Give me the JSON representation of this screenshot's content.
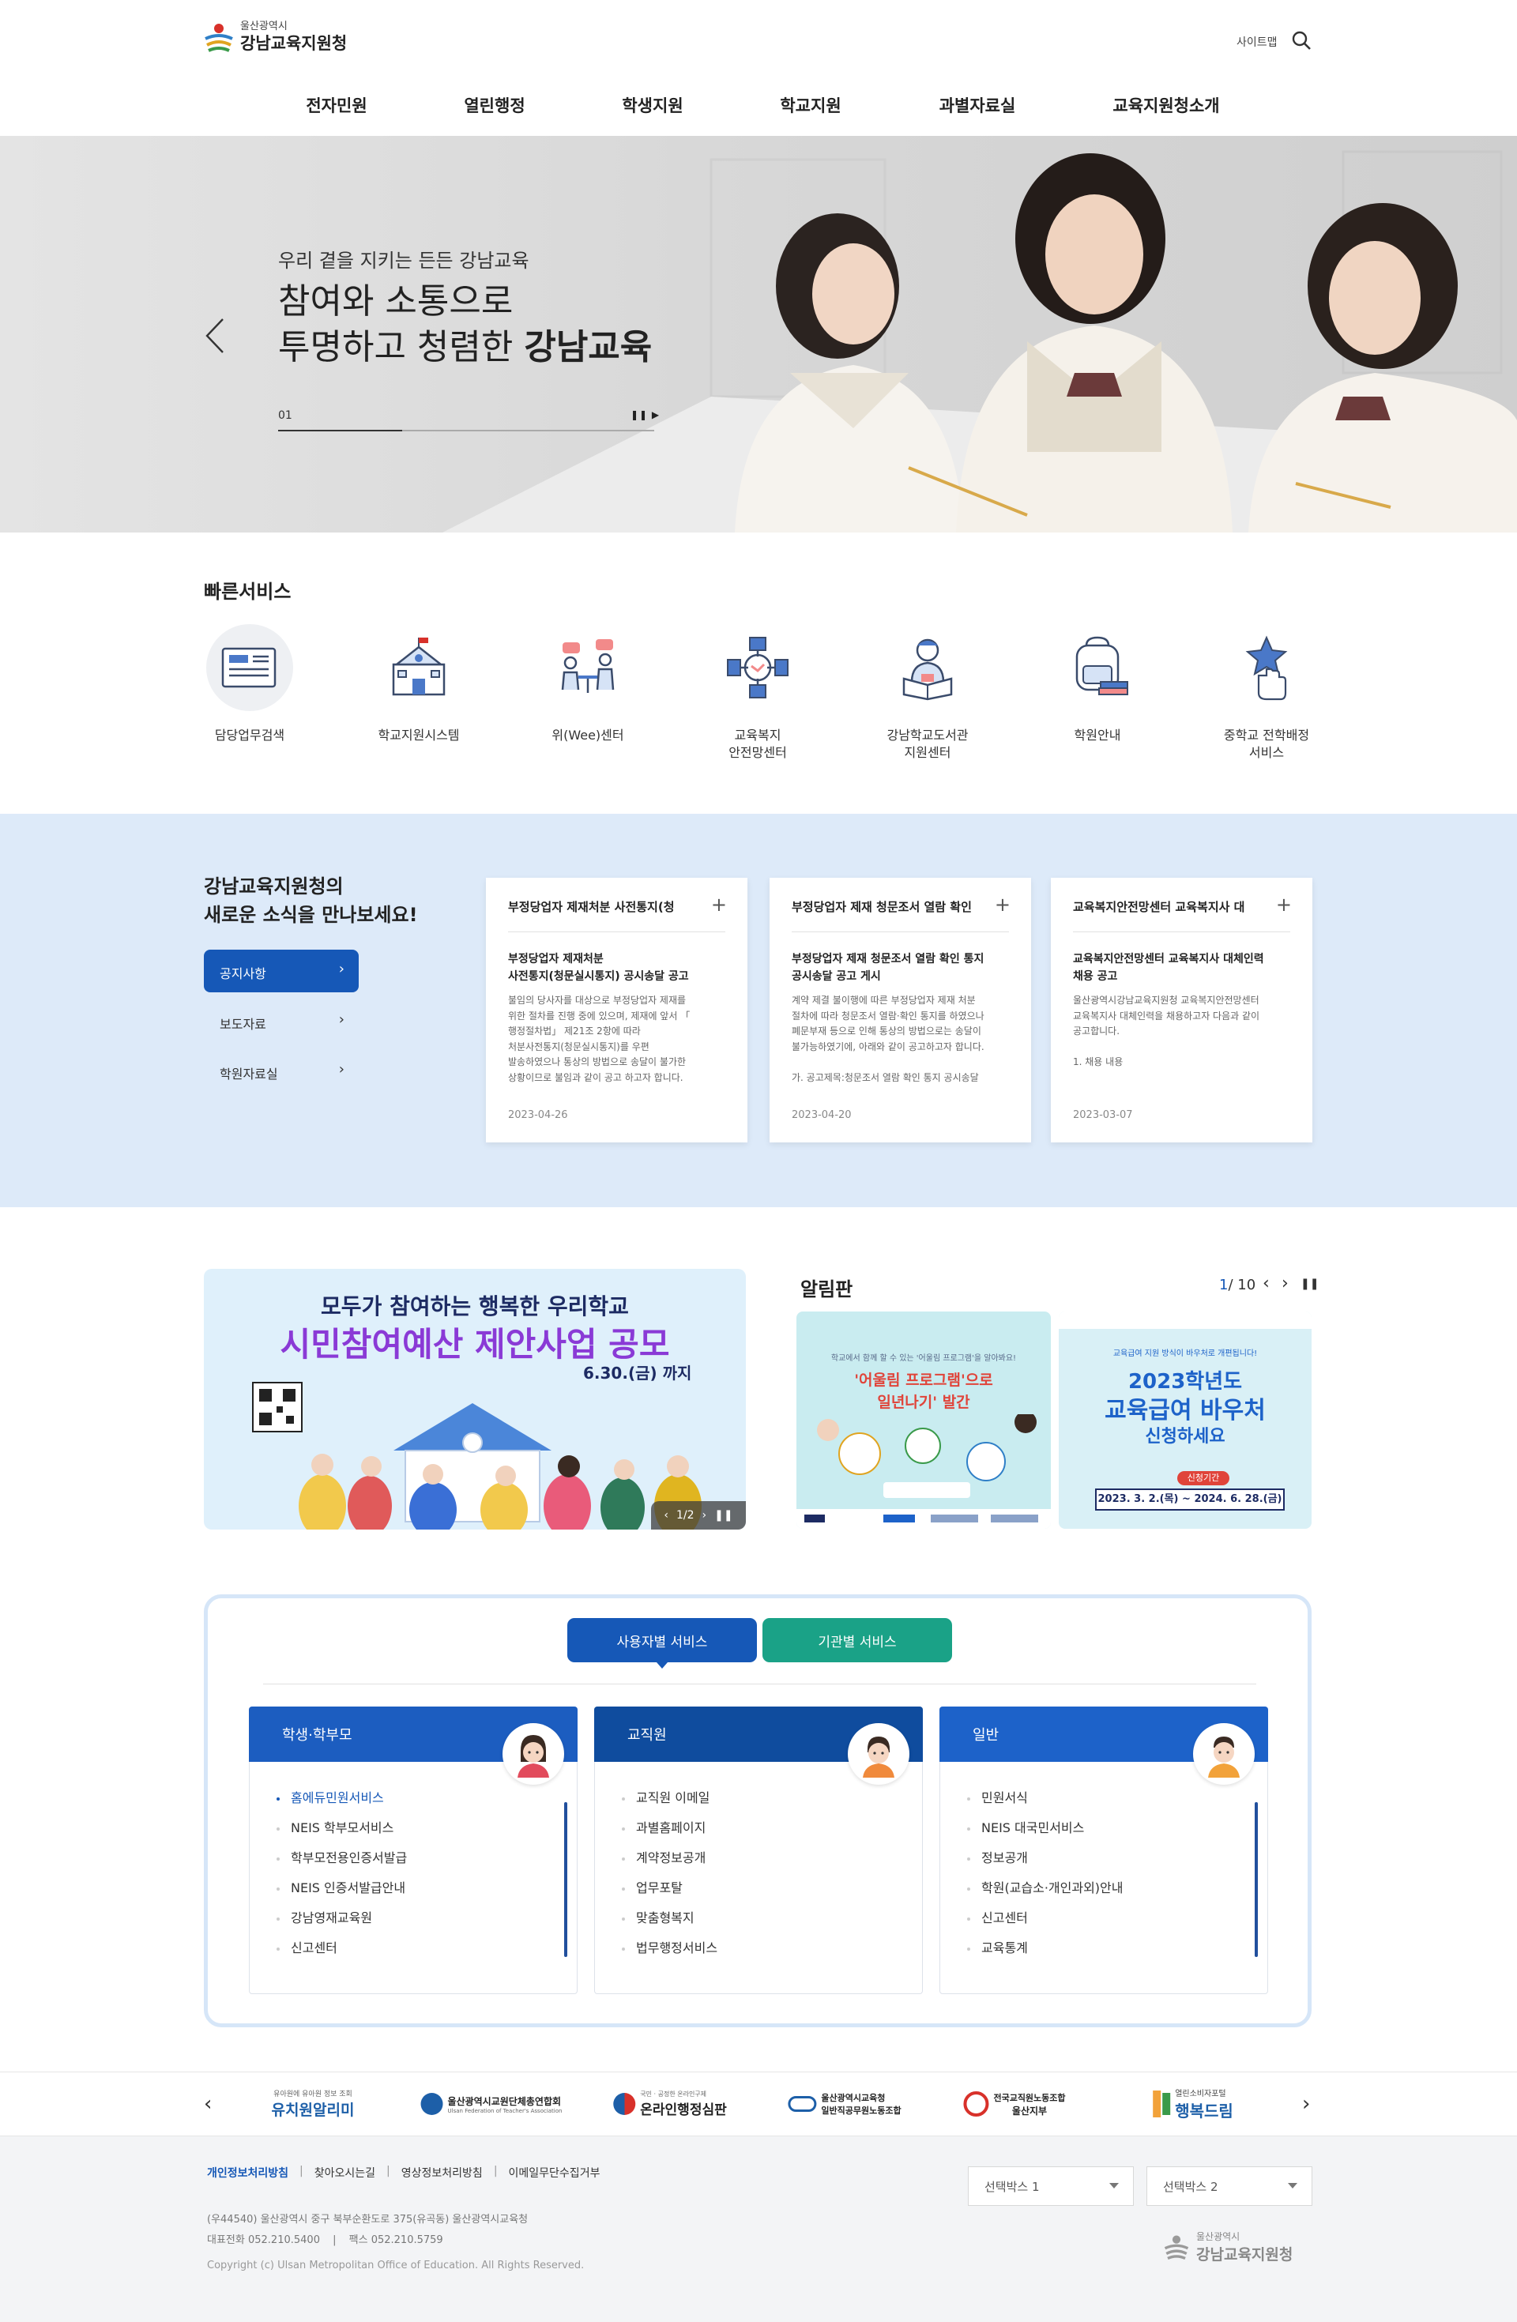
{
  "header": {
    "logo_small": "울산광역시",
    "logo_main": "강남교육지원청",
    "sitemap": "사이트맵",
    "nav": [
      "전자민원",
      "열린행정",
      "학생지원",
      "학교지원",
      "과별자료실",
      "교육지원청소개"
    ]
  },
  "hero": {
    "small": "우리 곁을 지키는 든든 강남교육",
    "line1": "참여와 소통으로",
    "line2_prefix": "투명하고 청렴한 ",
    "line2_bold": "강남교육",
    "slide_no": "01",
    "progress": 0.33
  },
  "quick": {
    "title": "빠른서비스",
    "items": [
      {
        "label": "담당업무검색",
        "icon": "document-icon"
      },
      {
        "label": "학교지원시스템",
        "icon": "school-building-icon"
      },
      {
        "label": "위(Wee)센터",
        "icon": "counseling-icon"
      },
      {
        "label": "교육복지\n안전망센터",
        "icon": "handshake-icon"
      },
      {
        "label": "강남학교도서관\n지원센터",
        "icon": "reading-icon"
      },
      {
        "label": "학원안내",
        "icon": "backpack-icon"
      },
      {
        "label": "중학교 전학배정\n서비스",
        "icon": "star-hand-icon"
      }
    ]
  },
  "news": {
    "heading1": "강남교육지원청의",
    "heading2": "새로운 소식을 만나보세요!",
    "tabs": [
      "공지사항",
      "보도자료",
      "학원자료실"
    ],
    "cards": [
      {
        "title": "부정당업자 제재처분 사전통지(청",
        "head": "부정당업자 제재처분\n사전통지(청문실시통지) 공시송달 공고",
        "body": "불임의 당사자를 대상으로 부정당업자 제재를\n위한 절차를 진행 중에 있으며, 제재에 앞서 「\n행정절차법」 제21조 2항에 따라\n처분사전통지(청문실시통지)를 우편\n발송하였으나 통상의 방법으로 송달이 불가한\n상황이므로 불임과 같이 공고 하고자 합니다.",
        "date": "2023-04-26"
      },
      {
        "title": "부정당업자 제재 청문조서 열람 확인",
        "head": "부정당업자 제재 청문조서 열람 확인 통지\n공시송달 공고 게시",
        "body": "계약 제결 불이행에 따른 부정당업자 제재 처분\n절차에 따라 청문조서 열람·확인 통지를 하였으나\n폐문부재 등으로 인해 통상의 방법으로는 송달이\n불가능하였기에, 아래와 같이 공고하고자 합니다.\n\n가. 공고제목:청문조서 열람 확인 통지 공시송달",
        "date": "2023-04-20"
      },
      {
        "title": "교육복지안전망센터 교육복지사 대",
        "head": "교육복지안전망센터 교육복지사 대체인력\n채용 공고",
        "body": "울산광역시강남교육지원청 교육복지안전망센터\n교육복지사 대체인력을 채용하고자 다음과 같이\n공고합니다.\n\n1. 채용 내용",
        "date": "2023-03-07"
      }
    ]
  },
  "promo": {
    "top": "모두가 참여하는 행복한 우리학교",
    "main": "시민참여예산 제안사업 공모",
    "date": "6.30.(금) 까지",
    "pager": "1/2"
  },
  "board": {
    "title": "알림판",
    "page_current": "1",
    "page_total": "/ 10",
    "card1_small": "학교에서 함께 할 수 있는 '어울림 프로그램'을 알아봐요!",
    "card1_main1": "'어울림 프로그램'으로",
    "card1_main2": "일년나기' 발간",
    "card2_small": "교육급여 지원 방식이 바우처로 개편됩니다!",
    "card2_main1": "2023학년도",
    "card2_main2": "교육급여 바우처",
    "card2_main3": "신청하세요",
    "card2_period_label": "신청기간",
    "card2_period": "2023. 3. 2.(목) ~ 2024. 6. 28.(금)"
  },
  "services": {
    "tab_active": "사용자별 서비스",
    "tab_other": "기관별 서비스",
    "boxes": [
      {
        "title": "학생·학부모",
        "color": "#1c5dc0",
        "items": [
          "홈에듀민원서비스",
          "NEIS 학부모서비스",
          "학부모전용인증서발급",
          "NEIS 인증서발급안내",
          "강남영재교육원",
          "신고센터"
        ]
      },
      {
        "title": "교직원",
        "color": "#0f4c9e",
        "items": [
          "교직원 이메일",
          "과별홈페이지",
          "계약정보공개",
          "업무포탈",
          "맞춤형복지",
          "법무행정서비스"
        ]
      },
      {
        "title": "일반",
        "color": "#1d62c9",
        "items": [
          "민원서식",
          "NEIS 대국민서비스",
          "정보공개",
          "학원(교습소·개인과외)안내",
          "신고센터",
          "교육통계"
        ]
      }
    ]
  },
  "banners": [
    {
      "small": "유아원에 유아원 정보 조회",
      "main": "유치원알리미"
    },
    {
      "small": "Ulsan Federation of Teacher's Association",
      "main": "울산광역시교원단체총연합회"
    },
    {
      "small": "국민 · 공정한 온라인구제",
      "main": "온라인행정심판"
    },
    {
      "small": "울산광역시교육청",
      "main": "일반직공무원노동조합"
    },
    {
      "small": "전국교직원노동조합",
      "main": "울산지부"
    },
    {
      "small": "열린소비자포털",
      "main": "행복드림"
    }
  ],
  "footer": {
    "links": [
      "개인정보처리방침",
      "찾아오시는길",
      "영상정보처리방침",
      "이메일무단수집거부"
    ],
    "address": "(우44540) 울산광역시 중구 북부순환도로 375(유곡동) 울산광역시교육청",
    "phone_label": "대표전화",
    "phone": "052.210.5400",
    "fax_label": "팩스",
    "fax": "052.210.5759",
    "copyright": "Copyright (c) Ulsan Metropolitan Office of Education. All Rights Reserved.",
    "select1": "선택박스 1",
    "select2": "선택박스 2",
    "logo_small": "울산광역시",
    "logo_main": "강남교육지원청"
  },
  "colors": {
    "primary": "#1658b7",
    "teal": "#1aa287",
    "news_bg": "#ddeaf9",
    "footer_bg": "#f3f4f6"
  }
}
